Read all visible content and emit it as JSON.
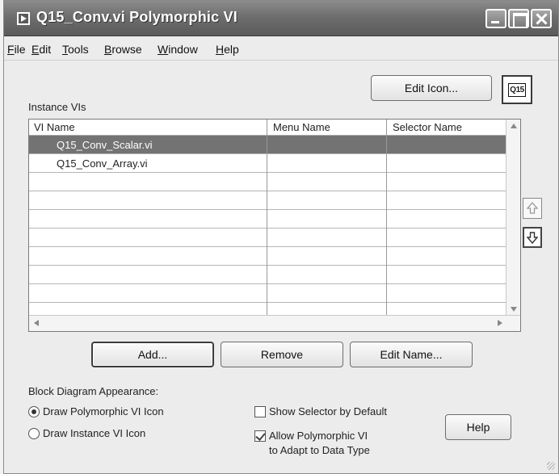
{
  "window": {
    "title": "Q15_Conv.vi Polymorphic VI"
  },
  "menu": [
    {
      "first": "F",
      "rest": "ile"
    },
    {
      "first": "E",
      "rest": "dit"
    },
    {
      "first": "T",
      "rest": "ools"
    },
    {
      "first": "B",
      "rest": "rowse"
    },
    {
      "first": "W",
      "rest": "indow"
    },
    {
      "first": "H",
      "rest": "elp"
    }
  ],
  "edit_icon_label": "Edit Icon...",
  "icon_preview_text": "Q15",
  "instance_label": "Instance VIs",
  "table": {
    "headers": [
      "VI Name",
      "Menu Name",
      "Selector Name"
    ],
    "rows": [
      {
        "vi_name": "Q15_Conv_Scalar.vi",
        "menu_name": "",
        "selector_name": "",
        "selected": true
      },
      {
        "vi_name": "Q15_Conv_Array.vi",
        "menu_name": "",
        "selector_name": "",
        "selected": false
      }
    ]
  },
  "buttons": {
    "add": "Add...",
    "remove": "Remove",
    "edit_name": "Edit Name...",
    "help": "Help"
  },
  "block_diagram": {
    "label": "Block Diagram Appearance:",
    "draw_poly_icon": "Draw Polymorphic VI Icon",
    "draw_instance_icon": "Draw Instance VI Icon",
    "draw_poly_selected": true
  },
  "options": {
    "show_selector": "Show Selector by Default",
    "show_selector_checked": false,
    "allow_adapt_line1": "Allow Polymorphic VI",
    "allow_adapt_line2": "to Adapt to Data Type",
    "allow_adapt_checked": true
  },
  "icons": {
    "up": "arrow-up-icon",
    "down": "arrow-down-icon"
  }
}
